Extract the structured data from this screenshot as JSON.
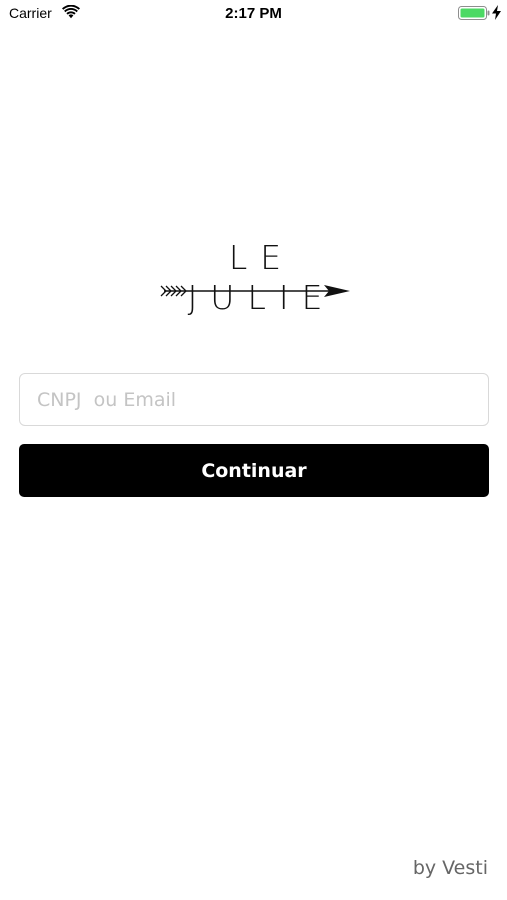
{
  "status_bar": {
    "carrier": "Carrier",
    "time": "2:17 PM",
    "icons": [
      "wifi-icon",
      "battery-icon",
      "charging-icon"
    ],
    "battery_color": "#4cd964"
  },
  "logo": {
    "text": "LE JULIE",
    "icon": "arrow-icon"
  },
  "login": {
    "placeholder": "CNPJ  ou Email",
    "value": "",
    "button_label": "Continuar",
    "button_color": "#000000"
  },
  "footer": {
    "brand": "by Vesti"
  }
}
